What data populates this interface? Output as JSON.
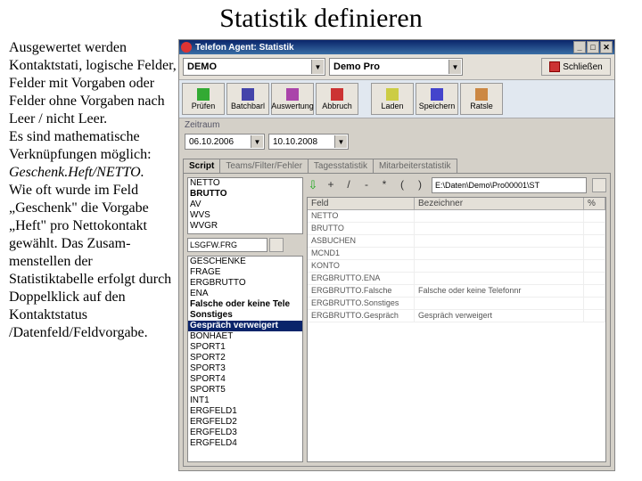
{
  "slide": {
    "title": "Statistik definieren"
  },
  "left_text": {
    "p1": "Ausgewertet werden Kontaktstati, logische Felder, Felder mit Vorgaben oder Felder ohne Vorgaben nach Leer / nicht Leer.",
    "p2a": "Es sind mathematische Verknüpfungen möglich: ",
    "p2b": "Geschenk.Heft/NETTO.",
    "p3": "Wie oft wurde im Feld „Geschenk\" die Vorgabe „Heft\" pro Nettokontakt gewählt. Das Zusam-menstellen der Statistiktabelle erfolgt durch Doppelklick auf den Kontaktstatus /Datenfeld/Feldvorgabe."
  },
  "window": {
    "title": "Telefon Agent: Statistik",
    "min": "_",
    "max": "□",
    "close": "✕",
    "project_combo": "DEMO",
    "project_desc": "Demo Pro",
    "close_btn": "Schließen"
  },
  "toolbar": {
    "b1": "Prüfen",
    "b2": "Batchbarl",
    "b3": "Auswertung",
    "b4": "Abbruch",
    "b5": "Laden",
    "b6": "Speichern",
    "b7": "Ratsle"
  },
  "zeitraum": {
    "label": "Zeitraum",
    "from": "06.10.2006",
    "to": "10.10.2008"
  },
  "tabs": {
    "t1": "Script",
    "t2": "Teams/Filter/Fehler",
    "t3": "Tagesstatistik",
    "t4": "Mitarbeiterstatistik"
  },
  "ops": {
    "plus": "+",
    "slash": "/",
    "minus": "-",
    "star": "*",
    "lp": "(",
    "rp": ")"
  },
  "script": {
    "path": "E:\\Daten\\Demo\\Pro00001\\ST",
    "list1": [
      "NETTO",
      "BRUTTO",
      "AV",
      "WVS",
      "WVGR"
    ],
    "scfile": "LSGFW.FRG",
    "list2_a": [
      "GESCHENKE",
      "FRAGE",
      "ERGBRUTTO",
      "ENA"
    ],
    "list2_fo": "Falsche oder keine Tele",
    "list2_so": "Sonstiges",
    "list2_sel": "Gespräch verweigert",
    "list2_b": [
      "BONHAET",
      "SPORT1",
      "SPORT2",
      "SPORT3",
      "SPORT4",
      "SPORT5",
      "INT1",
      "ERGFELD1",
      "ERGFELD2",
      "ERGFELD3",
      "ERGFELD4"
    ]
  },
  "grid": {
    "h1": "Feld",
    "h2": "Bezeichner",
    "h3": "%",
    "rows": [
      {
        "f": "NETTO",
        "b": ""
      },
      {
        "f": "BRUTTO",
        "b": ""
      },
      {
        "f": "ASBUCHEN",
        "b": ""
      },
      {
        "f": "MCND1",
        "b": ""
      },
      {
        "f": "KONTO",
        "b": ""
      },
      {
        "f": "ERGBRUTTO.ENA",
        "b": ""
      },
      {
        "f": "ERGBRUTTO.Falsche",
        "b": "Falsche oder keine Telefonnr"
      },
      {
        "f": "ERGBRUTTO.Sonstiges",
        "b": ""
      },
      {
        "f": "ERGBRUTTO.Gespräch",
        "b": "Gespräch verweigert"
      }
    ]
  }
}
